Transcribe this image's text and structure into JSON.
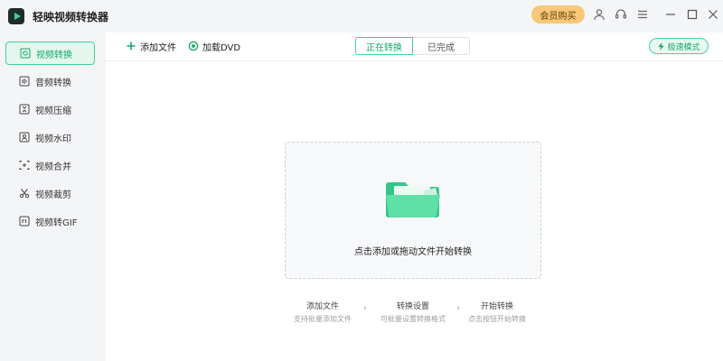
{
  "app": {
    "title": "轻映视频转换器"
  },
  "titlebar": {
    "vip_label": "会员购买",
    "icons": [
      "user-icon",
      "headset-icon",
      "menu-icon",
      "minimize-icon",
      "maximize-icon",
      "close-icon"
    ]
  },
  "sidebar": {
    "items": [
      {
        "label": "视频转换",
        "icon": "video-convert-icon",
        "active": true
      },
      {
        "label": "音频转换",
        "icon": "audio-convert-icon",
        "active": false
      },
      {
        "label": "视频压缩",
        "icon": "video-compress-icon",
        "active": false
      },
      {
        "label": "视频水印",
        "icon": "video-watermark-icon",
        "active": false
      },
      {
        "label": "视频合并",
        "icon": "video-merge-icon",
        "active": false
      },
      {
        "label": "视频裁剪",
        "icon": "video-cut-icon",
        "active": false
      },
      {
        "label": "视频转GIF",
        "icon": "video-gif-icon",
        "active": false
      }
    ]
  },
  "toolbar": {
    "add_file_label": "添加文件",
    "load_dvd_label": "加载DVD",
    "tabs": [
      {
        "label": "正在转换",
        "active": true
      },
      {
        "label": "已完成",
        "active": false
      }
    ],
    "turbo_label": "极速模式"
  },
  "dropzone": {
    "text": "点击添加或拖动文件开始转换"
  },
  "steps": [
    {
      "title": "添加文件",
      "desc": "支持批量添加文件"
    },
    {
      "title": "转换设置",
      "desc": "可批量设置转换格式"
    },
    {
      "title": "开始转换",
      "desc": "点击按钮开始转换"
    }
  ],
  "colors": {
    "accent": "#3fd39a",
    "accent_text": "#17a86b",
    "vip": "#f6c878"
  }
}
